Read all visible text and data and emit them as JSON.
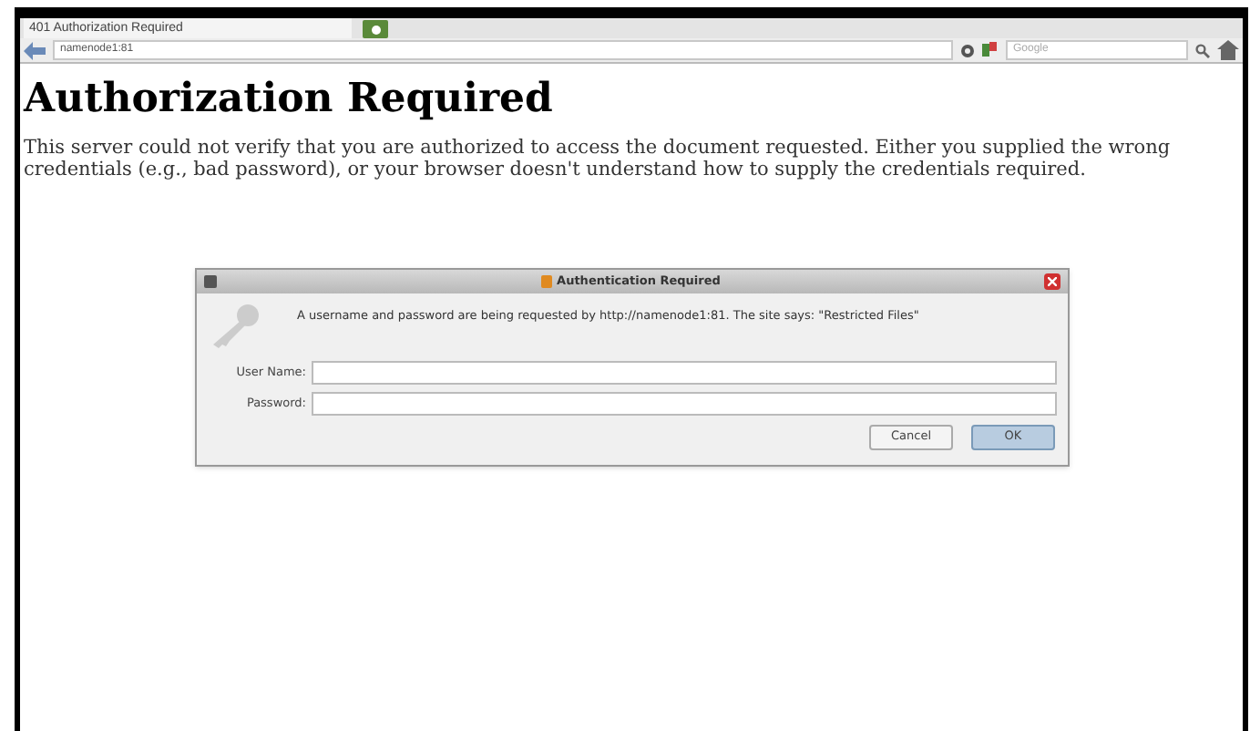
{
  "browser": {
    "tab": {
      "title": "401 Authorization Required",
      "selected": true
    },
    "url": "namenode1:81",
    "search": {
      "placeholder": "Google"
    }
  },
  "page": {
    "heading": "Authorization Required",
    "message": "This server could not verify that you are authorized to access the document requested. Either you supplied the wrong credentials (e.g., bad password), or your browser doesn't understand how to supply the credentials required."
  },
  "dialog": {
    "title": "Authentication Required",
    "prompt": "A username and password are being requested by http://namenode1:81. The site says: \"Restricted Files\"",
    "fields": [
      {
        "label": "User Name:"
      },
      {
        "label": "Password:"
      }
    ],
    "buttons": [
      {
        "label": "Cancel",
        "selected": false
      },
      {
        "label": "OK",
        "selected": true
      }
    ]
  }
}
